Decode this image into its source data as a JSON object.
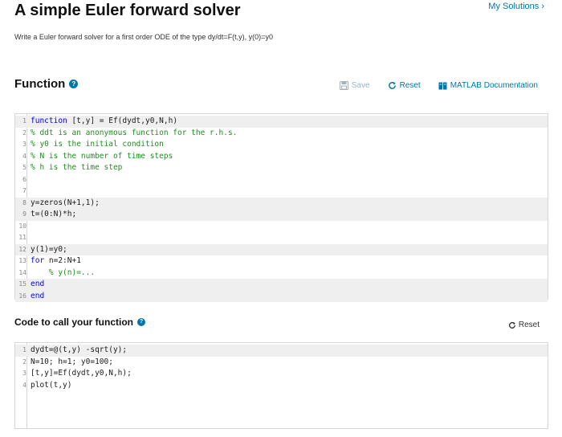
{
  "header": {
    "title": "A simple Euler forward solver",
    "my_solutions": "My Solutions",
    "my_solutions_chevron": "›",
    "description": "Write a Euler forward solver for a first order ODE of the type dy/dt=F(t,y), y(0)=y0"
  },
  "function_section": {
    "heading": "Function",
    "help_icon": "?",
    "toolbar": {
      "save": "Save",
      "reset": "Reset",
      "docs": "MATLAB Documentation"
    },
    "lines": [
      {
        "num": "1",
        "kw": "function",
        "text": " [t,y] = Ef(dydt,y0,N,h)",
        "cm": ""
      },
      {
        "num": "2",
        "kw": "",
        "text": "",
        "cm": "% ddt is an anonymous function for the r.h.s."
      },
      {
        "num": "3",
        "kw": "",
        "text": "",
        "cm": "% y0 is the initial condition"
      },
      {
        "num": "4",
        "kw": "",
        "text": "",
        "cm": "% N is the number of time steps"
      },
      {
        "num": "5",
        "kw": "",
        "text": "",
        "cm": "% h is the time step"
      },
      {
        "num": "6",
        "kw": "",
        "text": "",
        "cm": ""
      },
      {
        "num": "7",
        "kw": "",
        "text": "",
        "cm": ""
      },
      {
        "num": "8",
        "kw": "",
        "text": "y=zeros(N+1,1);",
        "cm": ""
      },
      {
        "num": "9",
        "kw": "",
        "text": "t=(0:N)*h;",
        "cm": ""
      },
      {
        "num": "10",
        "kw": "",
        "text": "",
        "cm": ""
      },
      {
        "num": "11",
        "kw": "",
        "text": "",
        "cm": ""
      },
      {
        "num": "12",
        "kw": "",
        "text": "y(1)=y0;",
        "cm": ""
      },
      {
        "num": "13",
        "kw": "for",
        "text": " n=2:N+1",
        "cm": ""
      },
      {
        "num": "14",
        "kw": "",
        "text": "    ",
        "cm": "% y(n)=..."
      },
      {
        "num": "15",
        "kw": "end",
        "text": "",
        "cm": ""
      },
      {
        "num": "16",
        "kw": "end",
        "text": "",
        "cm": ""
      }
    ]
  },
  "call_section": {
    "heading": "Code to call your function",
    "help_icon": "?",
    "reset": "Reset",
    "lines": [
      {
        "num": "1",
        "text": "dydt=@(t,y) -sqrt(y);"
      },
      {
        "num": "2",
        "text": "N=10; h=1; y0=100;"
      },
      {
        "num": "3",
        "text": "[t,y]=Ef(dydt,y0,N,h);"
      },
      {
        "num": "4",
        "text": "plot(t,y)"
      }
    ]
  },
  "colors": {
    "link": "#0076a8",
    "keyword": "#0000ff",
    "comment": "#228b22",
    "shade": "#efefef"
  },
  "icons": {
    "save": "floppy-disk-icon",
    "reset": "refresh-icon",
    "docs": "book-icon",
    "help": "question-circle-icon"
  }
}
